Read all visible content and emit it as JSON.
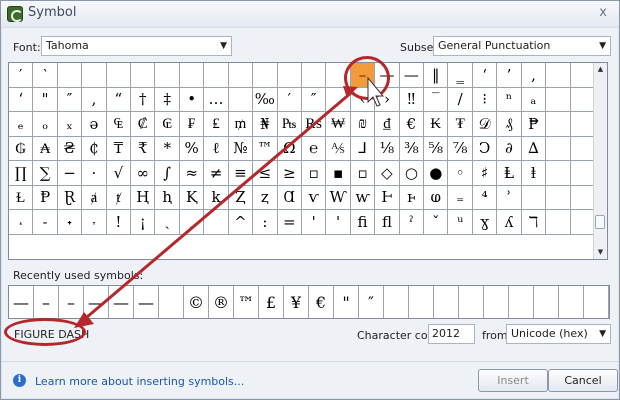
{
  "window": {
    "title": "Symbol",
    "close_glyph": "x"
  },
  "font": {
    "label": "Font:",
    "value": "Tahoma"
  },
  "subset": {
    "label": "Subset:",
    "value": "General Punctuation"
  },
  "grid_rows": [
    [
      "′",
      "‵",
      "",
      "",
      "",
      "",
      "",
      "",
      "",
      "",
      "",
      "",
      "",
      "",
      "–",
      "—",
      "—",
      "‖",
      "‗",
      "‘",
      "’",
      "‚",
      "",
      ""
    ],
    [
      "‘",
      "\"",
      "″",
      "‚",
      "“",
      "†",
      "‡",
      "•",
      "…",
      "",
      "‰",
      "′",
      "″",
      "",
      "‹",
      "›",
      "‼",
      "‾",
      "/",
      "⁝",
      "ⁿ",
      "ₐ",
      "",
      ""
    ],
    [
      "ₑ",
      "ₒ",
      "ₓ",
      "ə",
      "₠",
      "₡",
      "₢",
      "₣",
      "₤",
      "₥",
      "₦",
      "₧",
      "₨",
      "₩",
      "₪",
      "₫",
      "€",
      "₭",
      "₮",
      "𝒟",
      "₰",
      "₱",
      "",
      ""
    ],
    [
      "₲",
      "₳",
      "₴",
      "₵",
      "₸",
      "₹",
      "*",
      "%",
      "ℓ",
      "№",
      "™",
      "Ω",
      "℮",
      "⅍",
      "⅃",
      "⅛",
      "⅜",
      "⅝",
      "⅞",
      "Ↄ",
      "∂",
      "∆",
      "",
      ""
    ],
    [
      "∏",
      "∑",
      "−",
      "·",
      "√",
      "∞",
      "∫",
      "≈",
      "≠",
      "≡",
      "≤",
      "≥",
      "▫",
      "▪",
      "▫",
      "◇",
      "○",
      "●",
      "◦",
      "♯",
      "Ⱡ",
      "ⱡ",
      "",
      ""
    ],
    [
      "Ɫ",
      "Ᵽ",
      "Ɽ",
      "ⱥ",
      "ⱦ",
      "Ⱨ",
      "ⱨ",
      "Ⱪ",
      "ⱪ",
      "Ⱬ",
      "ⱬ",
      "Ɑ",
      "ⱱ",
      "Ⱳ",
      "ⱳ",
      "Ⱶ",
      "ⱶ",
      "ⱷ",
      "₌",
      "⁴",
      "ʾ",
      "",
      ""
    ],
    [
      "˔",
      "˗",
      "˖",
      "˕",
      "!",
      "¡",
      "ˎ",
      "ˏ",
      "",
      "^",
      ":",
      "=",
      "'",
      "'",
      "ﬁ",
      "ﬂ",
      "ˀ",
      "ˇ",
      "ᵘ",
      "ɣ",
      "ʎ",
      "ℸ",
      "",
      ""
    ]
  ],
  "selected": {
    "row": 0,
    "col": 14,
    "glyph": "–"
  },
  "recent": {
    "label": "Recently used symbols:",
    "items": [
      "—",
      "–",
      "–",
      "—",
      "—",
      "—",
      "",
      "©",
      "®",
      "™",
      "£",
      "¥",
      "€",
      "\"",
      "″",
      "",
      "",
      "",
      "",
      "",
      "",
      "",
      "",
      ""
    ]
  },
  "char_name": "FIGURE DASH",
  "char_code": {
    "label": "Character code:",
    "value": "2012"
  },
  "from": {
    "label": "from:",
    "value": "Unicode (hex)"
  },
  "learn_more": "Learn more about inserting symbols...",
  "buttons": {
    "insert": "Insert",
    "cancel": "Cancel"
  },
  "colors": {
    "callout": "#b4272b",
    "selection": "#f39a3c"
  }
}
